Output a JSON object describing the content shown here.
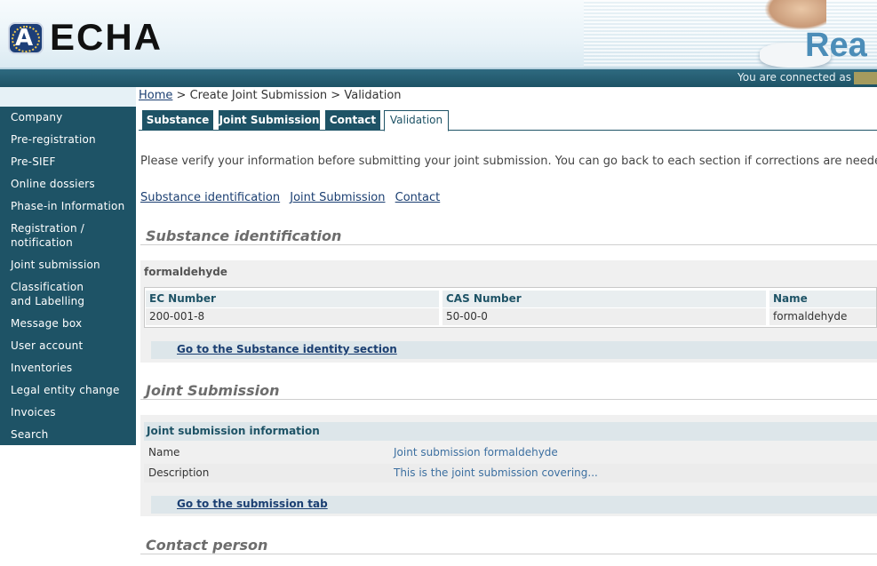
{
  "header": {
    "logo_text": "ECHA",
    "logo_mark": "A",
    "banner_text": "Rea"
  },
  "status": {
    "connected_label": "You are connected as"
  },
  "breadcrumb": {
    "home": "Home",
    "sep1": ">",
    "create": "Create Joint Submission",
    "sep2": ">",
    "current": "Validation"
  },
  "sidebar": {
    "items": [
      {
        "label": "Company"
      },
      {
        "label": "Pre-registration"
      },
      {
        "label": "Pre-SIEF"
      },
      {
        "label": "Online dossiers"
      },
      {
        "label": "Phase-in Information"
      },
      {
        "label": "Registration / notification"
      },
      {
        "label": "Joint submission"
      },
      {
        "label": "Classification and Labelling"
      },
      {
        "label": "Message box"
      },
      {
        "label": "User account"
      },
      {
        "label": "Inventories"
      },
      {
        "label": "Legal entity change"
      },
      {
        "label": "Invoices"
      },
      {
        "label": "Search"
      }
    ]
  },
  "tabs": [
    {
      "label": "Substance"
    },
    {
      "label": "Joint Submission"
    },
    {
      "label": "Contact"
    },
    {
      "label": "Validation"
    }
  ],
  "intro": "Please verify your information before submitting your joint submission. You can go back to each section if corrections are needed.",
  "quick_links": [
    "Substance identification",
    "Joint Submission",
    "Contact"
  ],
  "substance": {
    "title": "Substance identification",
    "name": "formaldehyde",
    "headers": [
      "EC Number",
      "CAS Number",
      "Name"
    ],
    "row": [
      "200-001-8",
      "50-00-0",
      "formaldehyde"
    ],
    "goto": "Go to the Substance identity section"
  },
  "joint": {
    "title": "Joint Submission",
    "header": "Joint submission information",
    "rows": [
      {
        "key": "Name",
        "value": "Joint submission formaldehyde"
      },
      {
        "key": "Description",
        "value": "This is the joint submission covering..."
      }
    ],
    "goto": "Go to the submission tab"
  },
  "contact": {
    "title": "Contact person"
  },
  "colors": {
    "nav_bg": "#1e5366",
    "link": "#1b3f72",
    "header_bg": "#e9f3f8"
  }
}
